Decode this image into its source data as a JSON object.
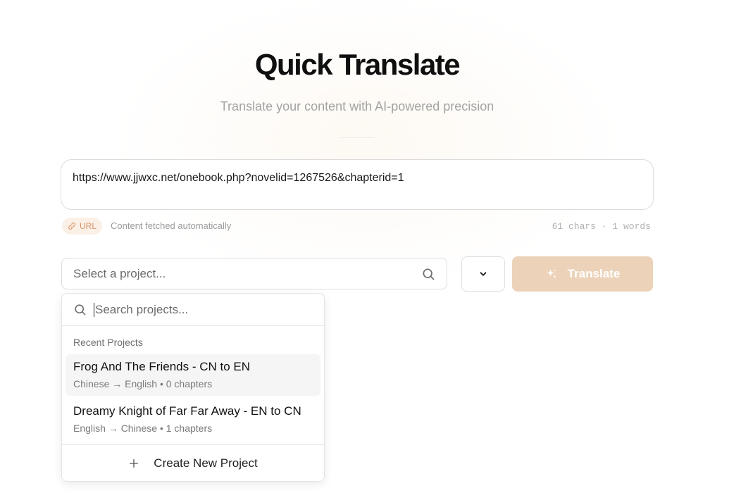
{
  "header": {
    "title": "Quick Translate",
    "subtitle": "Translate your content with AI-powered precision"
  },
  "input": {
    "value": "https://www.jjwxc.net/onebook.php?novelid=1267526&chapterid=1",
    "badge_label": "URL",
    "badge_icon": "link-icon",
    "status_text": "Content fetched automatically",
    "counts": "61 chars · 1 words"
  },
  "project_select": {
    "placeholder": "Select a project...",
    "icon": "search-icon"
  },
  "language_button": {
    "icon": "chevron-down-icon"
  },
  "translate_button": {
    "label": "Translate",
    "icon": "sparkle-icon"
  },
  "dropdown": {
    "search_placeholder": "Search projects...",
    "section_heading": "Recent Projects",
    "projects": [
      {
        "name": "Frog And The Friends - CN to EN",
        "details": "Chinese → English • 0 chapters"
      },
      {
        "name": "Dreamy Knight of Far Far Away - EN to CN",
        "details": "English → Chinese • 1 chapters"
      }
    ],
    "create_label": "Create New Project",
    "create_icon": "plus-icon"
  },
  "colors": {
    "accent": "#ecd2b8",
    "badge_bg": "#fbf0e6",
    "badge_text": "#d8956b"
  }
}
